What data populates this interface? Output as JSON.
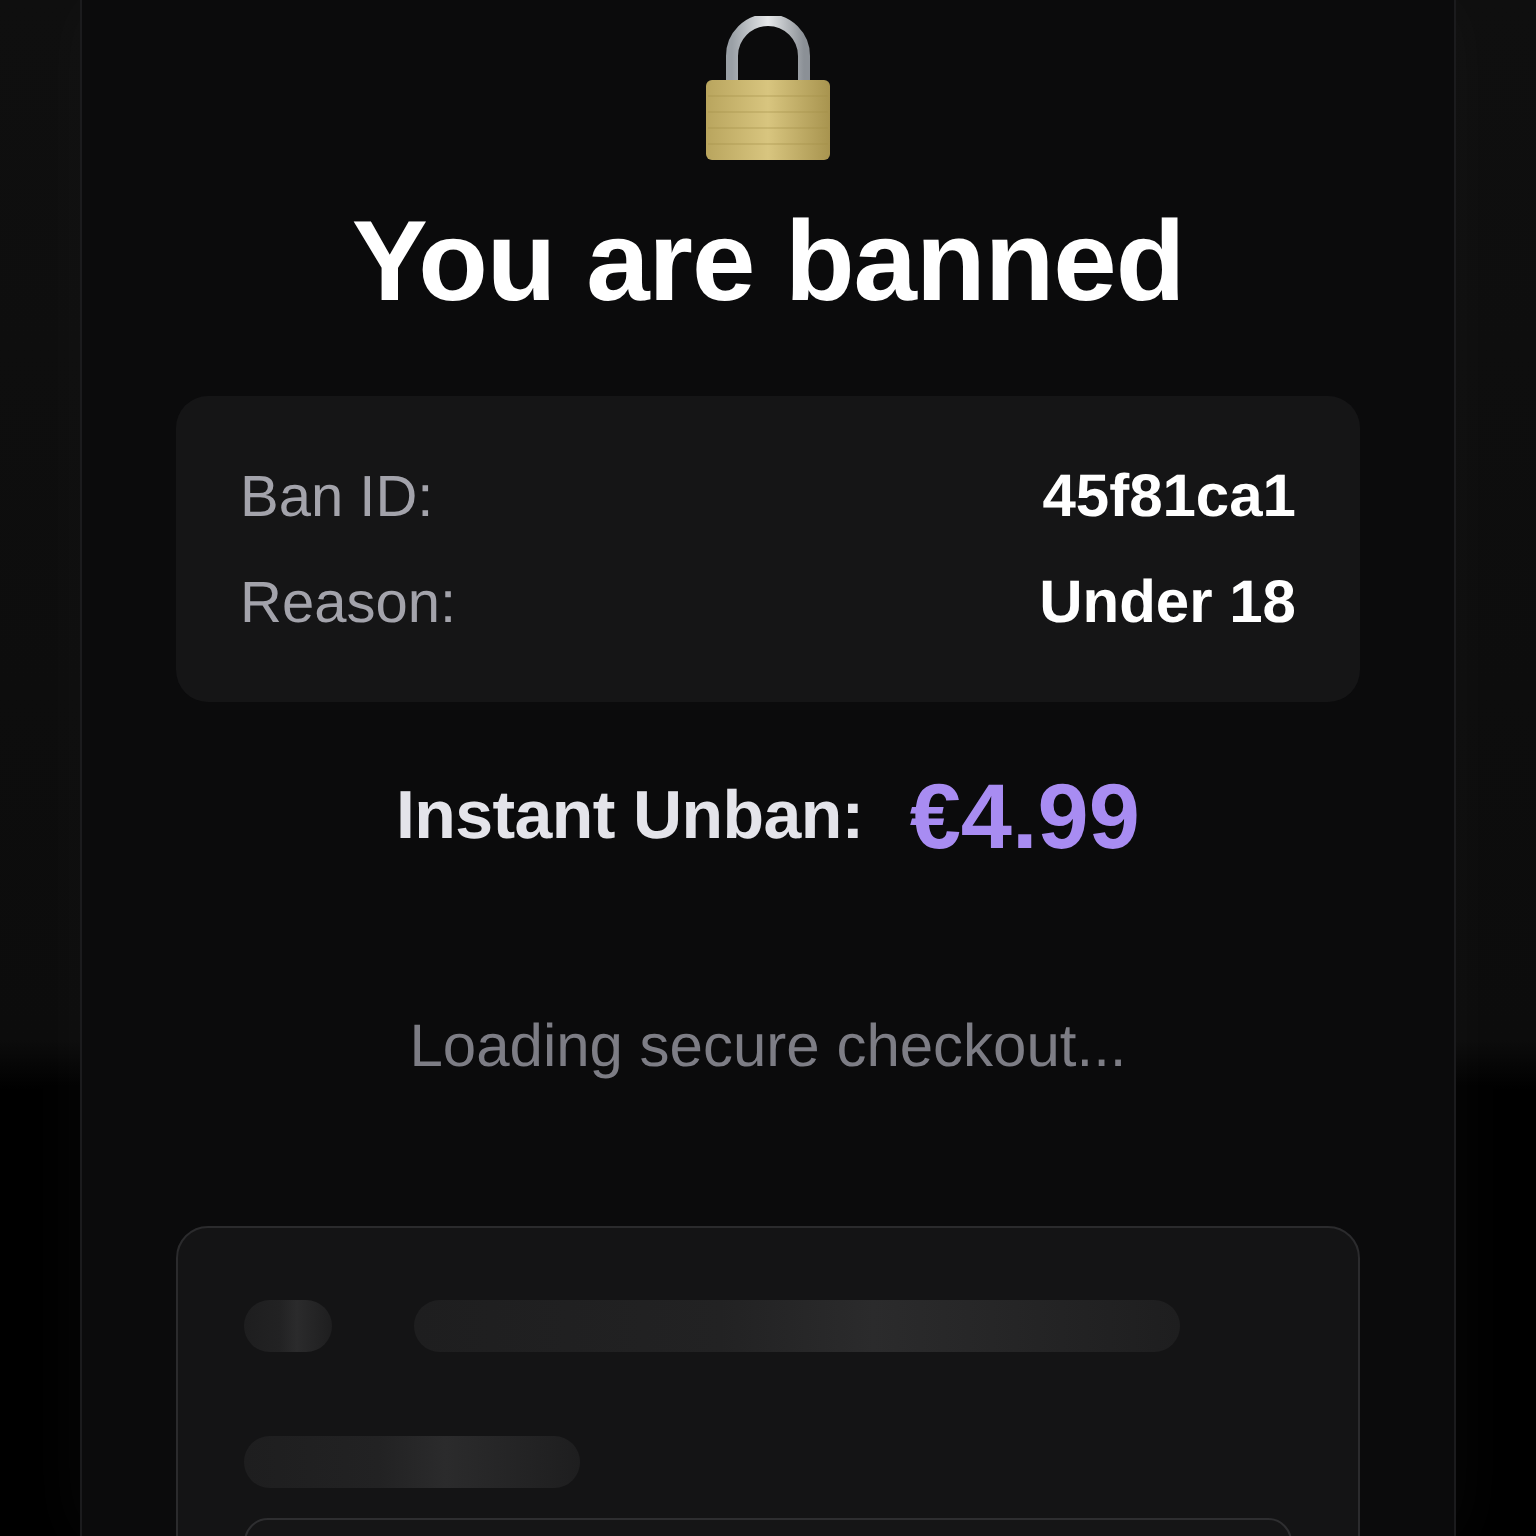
{
  "title": "You are banned",
  "details": [
    {
      "label": "Ban ID:",
      "value": "45f81ca1"
    },
    {
      "label": "Reason:",
      "value": "Under 18"
    }
  ],
  "offer": {
    "label": "Instant Unban:",
    "price": "€4.99"
  },
  "status": "Loading secure checkout..."
}
